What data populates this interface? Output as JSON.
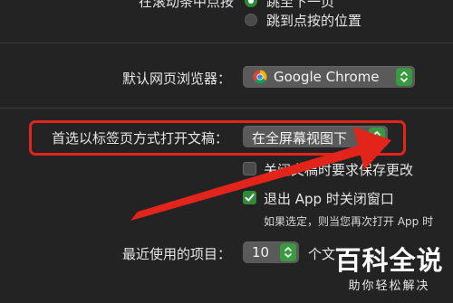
{
  "colors": {
    "background": "#232323",
    "accent_green": "#2f8b36",
    "highlight_red": "#e3241b"
  },
  "top": {
    "cut_label": "在滚动条中点按",
    "radio_selected_label": "跳至下一页",
    "radio_other_label": "跳到点按的位置"
  },
  "browser": {
    "label": "默认网页浏览器：",
    "value": "Google Chrome",
    "icon": "chrome-icon"
  },
  "tabs_pref": {
    "label": "首选以标签页方式打开文稿：",
    "value": "在全屏幕视图下"
  },
  "checks": {
    "ask_save": {
      "label": "关闭文稿时要求保存更改",
      "checked": false
    },
    "close_windows": {
      "label": "退出 App 时关闭窗口",
      "checked": true
    },
    "hint": "如果选定，则当您再次打开 App 时"
  },
  "recent": {
    "label": "最近使用的项目：",
    "value": "10",
    "suffix": "个文"
  },
  "watermark": {
    "main": "百科全说",
    "sub": "助你轻松解决"
  }
}
